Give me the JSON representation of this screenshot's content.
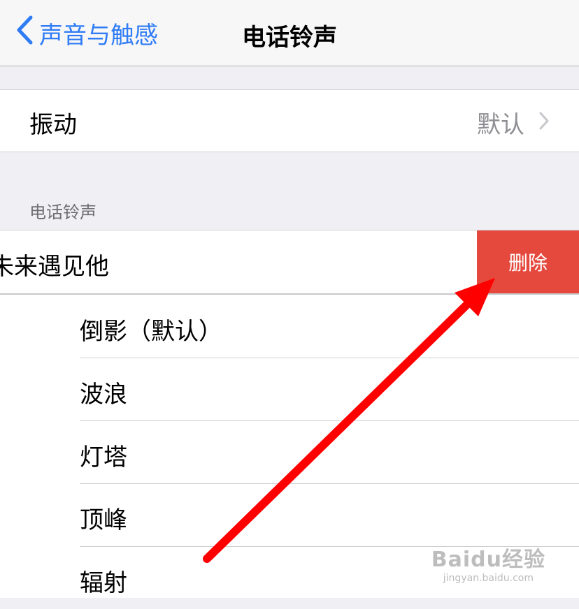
{
  "navbar": {
    "back_label": "声音与触感",
    "title": "电话铃声"
  },
  "vibration": {
    "label": "振动",
    "value": "默认"
  },
  "section_header": "电话铃声",
  "custom_ringtone": {
    "label": "未来遇见他",
    "delete_label": "删除"
  },
  "ringtones": [
    "倒影（默认）",
    "波浪",
    "灯塔",
    "顶峰",
    "辐射"
  ],
  "watermark": {
    "brand": "Baidu经验",
    "url": "jingyan.baidu.com"
  },
  "colors": {
    "accent": "#2f7cf6",
    "delete": "#e5483c",
    "arrow": "#ff0000"
  }
}
